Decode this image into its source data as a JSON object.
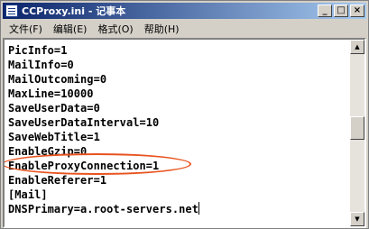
{
  "window": {
    "title": "CCProxy.ini - 记事本",
    "minimize_glyph": "_",
    "maximize_glyph": "□",
    "close_glyph": "×"
  },
  "menu": [
    {
      "label": "文件(F)"
    },
    {
      "label": "编辑(E)"
    },
    {
      "label": "格式(O)"
    },
    {
      "label": "帮助(H)"
    }
  ],
  "editor": {
    "lines": [
      "PicInfo=1",
      "MailInfo=0",
      "MailOutcoming=0",
      "MaxLine=10000",
      "SaveUserData=0",
      "SaveUserDataInterval=10",
      "SaveWebTitle=1",
      "EnableGzip=0",
      "EnableProxyConnection=1",
      "EnableReferer=1",
      "[Mail]",
      "DNSPrimary=a.root-servers.net"
    ],
    "highlighted_line": "EnableProxyConnection=1",
    "highlight_color": "#e8531f"
  },
  "scrollbar": {
    "up_glyph": "▲",
    "down_glyph": "▼",
    "position": 0.46
  },
  "icons": {
    "app": "notepad-icon"
  }
}
